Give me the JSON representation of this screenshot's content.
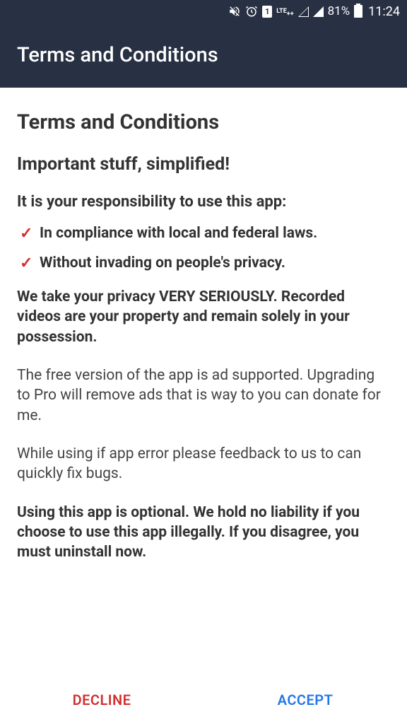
{
  "status": {
    "sim": "1",
    "lte": "LTE",
    "battery_pct": "81%",
    "time": "11:24"
  },
  "appbar": {
    "title": "Terms and Conditions"
  },
  "content": {
    "heading": "Terms and Conditions",
    "subheading": "Important stuff, simplified!",
    "responsibility_title": "It is your responsibility to use this app:",
    "bullets": [
      "In compliance with local and federal laws.",
      "Without invading on people's privacy."
    ],
    "privacy": "We take your privacy VERY SERIOUSLY. Recorded videos are your property and remain solely in your possession.",
    "free_version": "The free version of the app is ad supported. Upgrading to Pro will remove ads that is way to you can donate for me.",
    "feedback": "While using if app error please feedback to us to can quickly fix bugs.",
    "liability": "Using this app is optional. We hold no liability if you choose to use this app illegally. If you disagree, you must uninstall now."
  },
  "footer": {
    "decline": "DECLINE",
    "accept": "ACCEPT"
  }
}
